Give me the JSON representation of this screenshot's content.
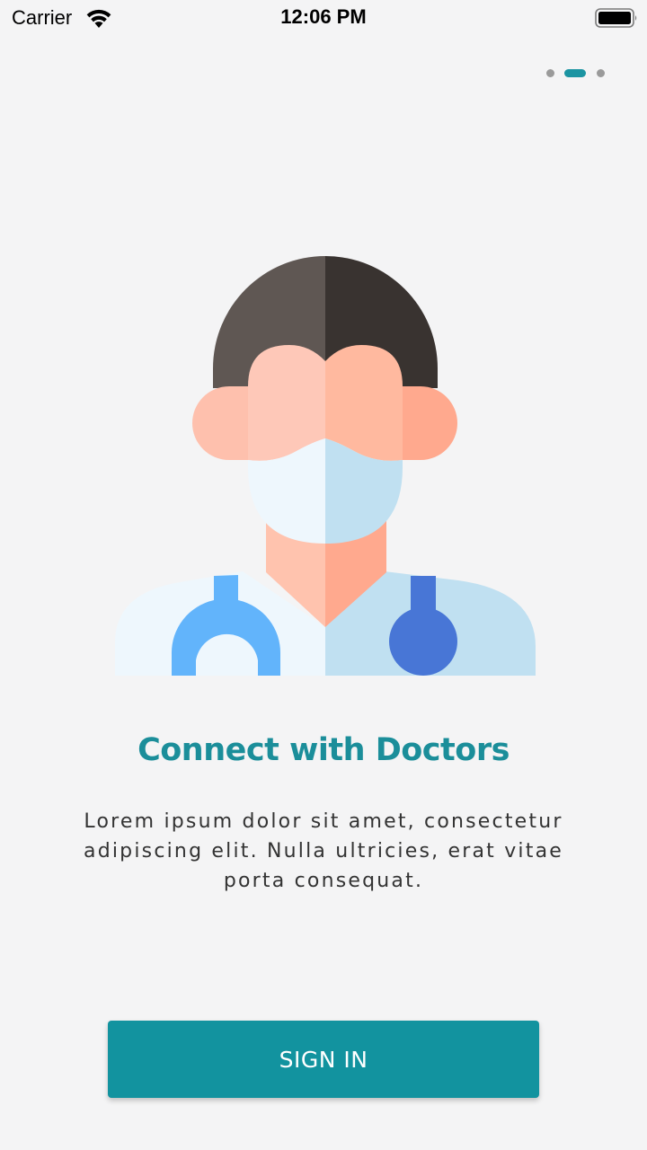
{
  "status_bar": {
    "carrier": "Carrier",
    "time": "12:06 PM",
    "icons": [
      "wifi-icon",
      "battery-icon"
    ]
  },
  "pager": {
    "total": 3,
    "active_index": 1
  },
  "onboarding": {
    "illustration": "doctor-avatar-icon",
    "title": "Connect with Doctors",
    "description": "Lorem ipsum dolor sit amet, consectetur adipiscing elit. Nulla ultricies, erat vitae porta consequat."
  },
  "actions": {
    "sign_in_label": "SIGN IN"
  },
  "colors": {
    "accent": "#12939f",
    "title": "#1b8e9a",
    "background": "#f4f4f5"
  }
}
